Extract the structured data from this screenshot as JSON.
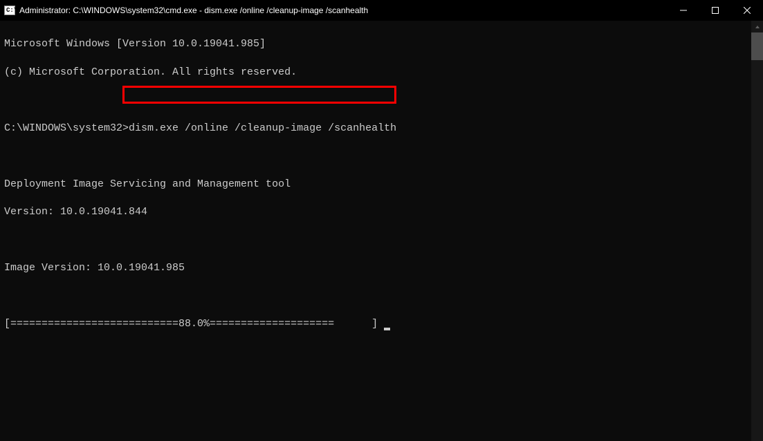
{
  "window": {
    "title": "Administrator: C:\\WINDOWS\\system32\\cmd.exe - dism.exe  /online /cleanup-image /scanhealth"
  },
  "terminal": {
    "line1": "Microsoft Windows [Version 10.0.19041.985]",
    "line2": "(c) Microsoft Corporation. All rights reserved.",
    "prompt": "C:\\WINDOWS\\system32>",
    "command": "dism.exe /online /cleanup-image /scanhealth",
    "tool_name": "Deployment Image Servicing and Management tool",
    "tool_version": "Version: 10.0.19041.844",
    "image_version": "Image Version: 10.0.19041.985",
    "progress": "[===========================88.0%====================      ] "
  }
}
